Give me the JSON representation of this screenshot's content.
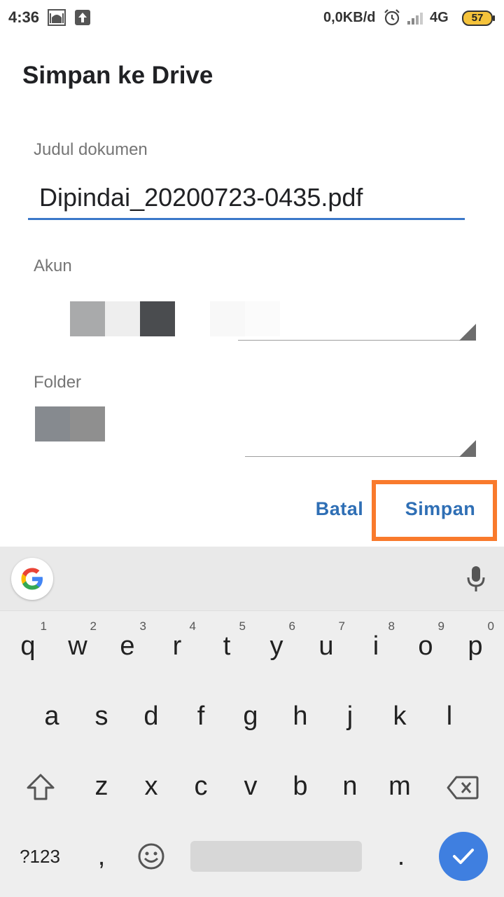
{
  "status_bar": {
    "time": "4:36",
    "network_speed": "0,0KB/d",
    "network_type": "4G",
    "battery": "57",
    "icons": [
      "mosque-notification-icon",
      "upload-icon",
      "alarm-icon",
      "signal-icon",
      "battery-icon"
    ]
  },
  "dialog": {
    "title": "Simpan ke Drive",
    "doc_title_label": "Judul dokumen",
    "doc_title_value": "Dipindai_20200723-0435.pdf",
    "account_label": "Akun",
    "folder_label": "Folder",
    "cancel_label": "Batal",
    "save_label": "Simpan",
    "accent_color": "#2f6fb5",
    "highlight_color": "#f97a2c"
  },
  "keyboard": {
    "row1": [
      {
        "k": "q",
        "h": "1"
      },
      {
        "k": "w",
        "h": "2"
      },
      {
        "k": "e",
        "h": "3"
      },
      {
        "k": "r",
        "h": "4"
      },
      {
        "k": "t",
        "h": "5"
      },
      {
        "k": "y",
        "h": "6"
      },
      {
        "k": "u",
        "h": "7"
      },
      {
        "k": "i",
        "h": "8"
      },
      {
        "k": "o",
        "h": "9"
      },
      {
        "k": "p",
        "h": "0"
      }
    ],
    "row2": [
      "a",
      "s",
      "d",
      "f",
      "g",
      "h",
      "j",
      "k",
      "l"
    ],
    "row3": [
      "z",
      "x",
      "c",
      "v",
      "b",
      "n",
      "m"
    ],
    "symbols_label": "?123",
    "comma": ",",
    "period": ".",
    "icons": [
      "google-icon",
      "mic-icon",
      "shift-icon",
      "backspace-icon",
      "emoji-icon",
      "enter-check-icon"
    ]
  }
}
